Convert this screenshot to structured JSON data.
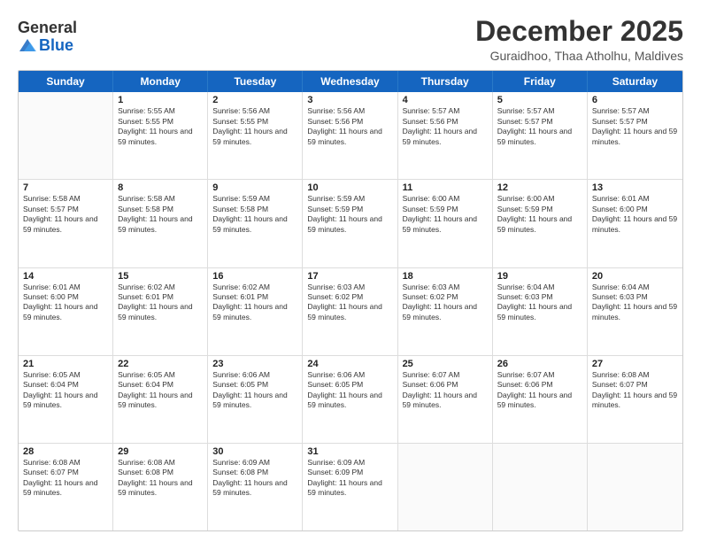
{
  "header": {
    "logo_general": "General",
    "logo_blue": "Blue",
    "month_title": "December 2025",
    "location": "Guraidhoo, Thaa Atholhu, Maldives"
  },
  "calendar": {
    "days": [
      "Sunday",
      "Monday",
      "Tuesday",
      "Wednesday",
      "Thursday",
      "Friday",
      "Saturday"
    ],
    "rows": [
      [
        {
          "day": "",
          "empty": true
        },
        {
          "day": "1",
          "sunrise": "5:55 AM",
          "sunset": "5:55 PM",
          "daylight": "11 hours and 59 minutes."
        },
        {
          "day": "2",
          "sunrise": "5:56 AM",
          "sunset": "5:55 PM",
          "daylight": "11 hours and 59 minutes."
        },
        {
          "day": "3",
          "sunrise": "5:56 AM",
          "sunset": "5:56 PM",
          "daylight": "11 hours and 59 minutes."
        },
        {
          "day": "4",
          "sunrise": "5:57 AM",
          "sunset": "5:56 PM",
          "daylight": "11 hours and 59 minutes."
        },
        {
          "day": "5",
          "sunrise": "5:57 AM",
          "sunset": "5:57 PM",
          "daylight": "11 hours and 59 minutes."
        },
        {
          "day": "6",
          "sunrise": "5:57 AM",
          "sunset": "5:57 PM",
          "daylight": "11 hours and 59 minutes."
        }
      ],
      [
        {
          "day": "7",
          "sunrise": "5:58 AM",
          "sunset": "5:57 PM",
          "daylight": "11 hours and 59 minutes."
        },
        {
          "day": "8",
          "sunrise": "5:58 AM",
          "sunset": "5:58 PM",
          "daylight": "11 hours and 59 minutes."
        },
        {
          "day": "9",
          "sunrise": "5:59 AM",
          "sunset": "5:58 PM",
          "daylight": "11 hours and 59 minutes."
        },
        {
          "day": "10",
          "sunrise": "5:59 AM",
          "sunset": "5:59 PM",
          "daylight": "11 hours and 59 minutes."
        },
        {
          "day": "11",
          "sunrise": "6:00 AM",
          "sunset": "5:59 PM",
          "daylight": "11 hours and 59 minutes."
        },
        {
          "day": "12",
          "sunrise": "6:00 AM",
          "sunset": "5:59 PM",
          "daylight": "11 hours and 59 minutes."
        },
        {
          "day": "13",
          "sunrise": "6:01 AM",
          "sunset": "6:00 PM",
          "daylight": "11 hours and 59 minutes."
        }
      ],
      [
        {
          "day": "14",
          "sunrise": "6:01 AM",
          "sunset": "6:00 PM",
          "daylight": "11 hours and 59 minutes."
        },
        {
          "day": "15",
          "sunrise": "6:02 AM",
          "sunset": "6:01 PM",
          "daylight": "11 hours and 59 minutes."
        },
        {
          "day": "16",
          "sunrise": "6:02 AM",
          "sunset": "6:01 PM",
          "daylight": "11 hours and 59 minutes."
        },
        {
          "day": "17",
          "sunrise": "6:03 AM",
          "sunset": "6:02 PM",
          "daylight": "11 hours and 59 minutes."
        },
        {
          "day": "18",
          "sunrise": "6:03 AM",
          "sunset": "6:02 PM",
          "daylight": "11 hours and 59 minutes."
        },
        {
          "day": "19",
          "sunrise": "6:04 AM",
          "sunset": "6:03 PM",
          "daylight": "11 hours and 59 minutes."
        },
        {
          "day": "20",
          "sunrise": "6:04 AM",
          "sunset": "6:03 PM",
          "daylight": "11 hours and 59 minutes."
        }
      ],
      [
        {
          "day": "21",
          "sunrise": "6:05 AM",
          "sunset": "6:04 PM",
          "daylight": "11 hours and 59 minutes."
        },
        {
          "day": "22",
          "sunrise": "6:05 AM",
          "sunset": "6:04 PM",
          "daylight": "11 hours and 59 minutes."
        },
        {
          "day": "23",
          "sunrise": "6:06 AM",
          "sunset": "6:05 PM",
          "daylight": "11 hours and 59 minutes."
        },
        {
          "day": "24",
          "sunrise": "6:06 AM",
          "sunset": "6:05 PM",
          "daylight": "11 hours and 59 minutes."
        },
        {
          "day": "25",
          "sunrise": "6:07 AM",
          "sunset": "6:06 PM",
          "daylight": "11 hours and 59 minutes."
        },
        {
          "day": "26",
          "sunrise": "6:07 AM",
          "sunset": "6:06 PM",
          "daylight": "11 hours and 59 minutes."
        },
        {
          "day": "27",
          "sunrise": "6:08 AM",
          "sunset": "6:07 PM",
          "daylight": "11 hours and 59 minutes."
        }
      ],
      [
        {
          "day": "28",
          "sunrise": "6:08 AM",
          "sunset": "6:07 PM",
          "daylight": "11 hours and 59 minutes."
        },
        {
          "day": "29",
          "sunrise": "6:08 AM",
          "sunset": "6:08 PM",
          "daylight": "11 hours and 59 minutes."
        },
        {
          "day": "30",
          "sunrise": "6:09 AM",
          "sunset": "6:08 PM",
          "daylight": "11 hours and 59 minutes."
        },
        {
          "day": "31",
          "sunrise": "6:09 AM",
          "sunset": "6:09 PM",
          "daylight": "11 hours and 59 minutes."
        },
        {
          "day": "",
          "empty": true
        },
        {
          "day": "",
          "empty": true
        },
        {
          "day": "",
          "empty": true
        }
      ]
    ]
  }
}
